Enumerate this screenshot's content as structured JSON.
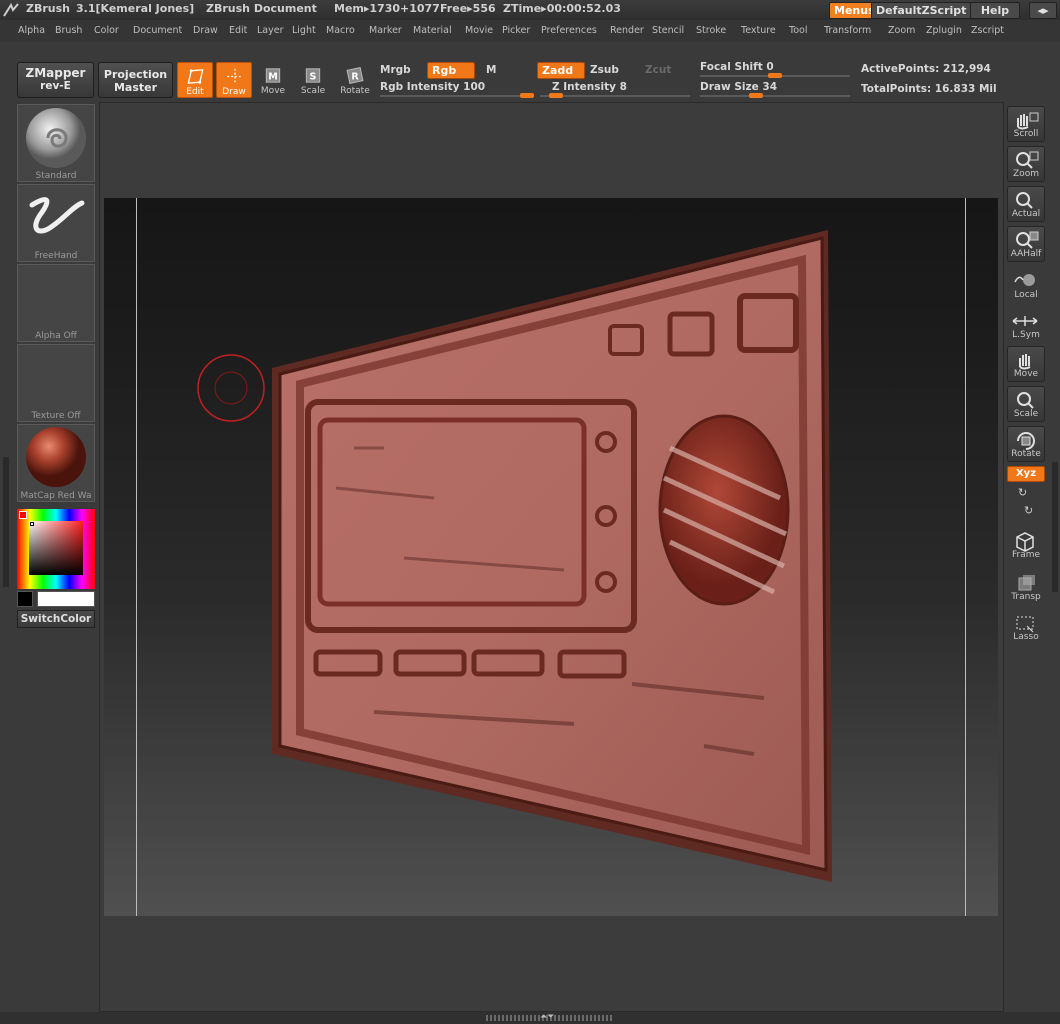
{
  "title_bar": {
    "app": "ZBrush",
    "version": "3.1[Kemeral Jones]",
    "document": "ZBrush Document",
    "mem": "Mem▸1730+1077",
    "free": "Free▸556",
    "ztime": "ZTime▸00:00:52.03",
    "menus_button": "Menus",
    "script_button": "DefaultZScript",
    "help_button": "Help"
  },
  "menu_bar": [
    "Alpha",
    "Brush",
    "Color",
    "Document",
    "Draw",
    "Edit",
    "Layer",
    "Light",
    "Macro",
    "Marker",
    "Material",
    "Movie",
    "Picker",
    "Preferences",
    "Render",
    "Stencil",
    "Stroke",
    "Texture",
    "Tool",
    "Transform",
    "Zoom",
    "Zplugin",
    "Zscript"
  ],
  "toolbar": {
    "zmapper_line1": "ZMapper",
    "zmapper_line2": "rev-E",
    "projection_line1": "Projection",
    "projection_line2": "Master",
    "edit": "Edit",
    "draw": "Draw",
    "move": "Move",
    "scale": "Scale",
    "rotate": "Rotate",
    "mrgb": "Mrgb",
    "rgb": "Rgb",
    "m": "M",
    "rgb_intensity": "Rgb  Intensity 100",
    "zadd": "Zadd",
    "zsub": "Zsub",
    "zcut": "Zcut",
    "z_intensity": "Z  Intensity 8",
    "focal_shift": "Focal  Shift 0",
    "draw_size": "Draw  Size 34",
    "active_points": "ActivePoints: 212,994",
    "total_points": "TotalPoints: 16.833 Mil"
  },
  "left_shelf": {
    "brush": "Standard",
    "stroke": "FreeHand",
    "alpha": "Alpha  Off",
    "texture": "Texture  Off",
    "material": "MatCap  Red  Wa",
    "switch_color": "SwitchColor"
  },
  "right_shelf": [
    "Scroll",
    "Zoom",
    "Actual",
    "AAHalf",
    "Local",
    "L.Sym",
    "Move",
    "Scale",
    "Rotate",
    "Xyz",
    "Frame",
    "Transp",
    "Lasso"
  ],
  "colors": {
    "accent": "#f07818",
    "model": "#b06a62",
    "brush_cursor": "#c02020"
  }
}
